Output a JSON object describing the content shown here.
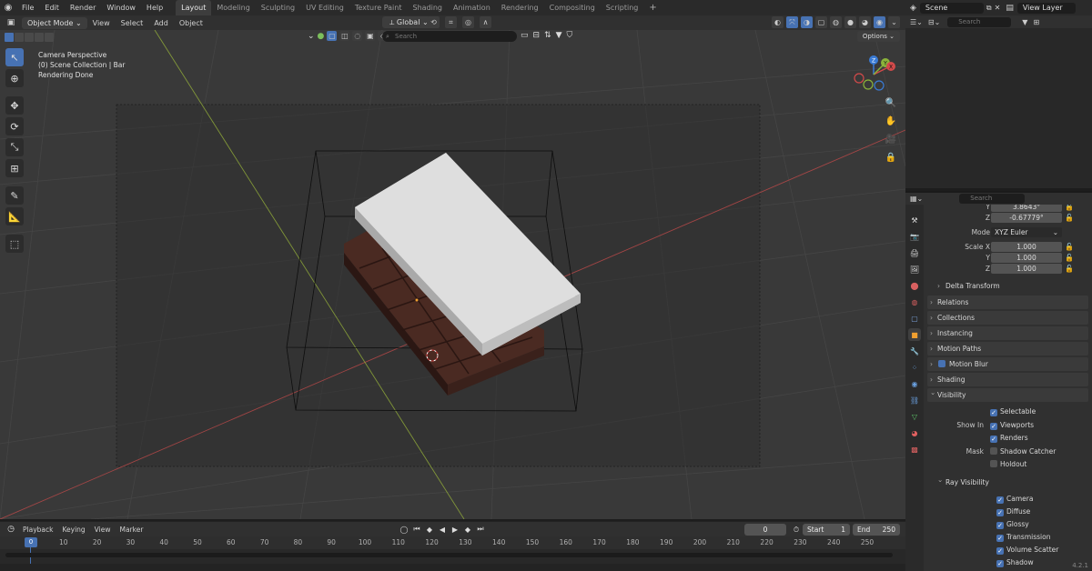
{
  "menubar": {
    "items": [
      "File",
      "Edit",
      "Render",
      "Window",
      "Help"
    ],
    "workspaces": [
      "Layout",
      "Modeling",
      "Sculpting",
      "UV Editing",
      "Texture Paint",
      "Shading",
      "Animation",
      "Rendering",
      "Compositing",
      "Scripting"
    ],
    "active_workspace": "Layout",
    "plus": "+"
  },
  "viewport_header": {
    "mode": "Object Mode",
    "menus": [
      "View",
      "Select",
      "Add",
      "Object"
    ],
    "orientation": "Global"
  },
  "viewport_toolbar2": {
    "search_placeholder": "Search",
    "options": "Options"
  },
  "viewport_info": {
    "line1": "Camera Perspective",
    "line2": "(0) Scene Collection | Bar",
    "line3": "Rendering Done"
  },
  "gizmo": {
    "x": "X",
    "y": "Y",
    "z": "Z"
  },
  "outliner": {
    "scene": "Scene",
    "view_layer": "View Layer",
    "search_placeholder": "Search"
  },
  "properties": {
    "search_placeholder": "Search",
    "rotation_y_label": "Y",
    "rotation_y_value": "3.8643°",
    "rotation_z_label": "Z",
    "rotation_z_value": "-0.67779°",
    "mode_label": "Mode",
    "mode_value": "XYZ Euler",
    "scale_x_label": "Scale X",
    "scale_x_value": "1.000",
    "scale_y_label": "Y",
    "scale_y_value": "1.000",
    "scale_z_label": "Z",
    "scale_z_value": "1.000",
    "delta_transform": "Delta Transform",
    "panels": [
      "Relations",
      "Collections",
      "Instancing",
      "Motion Paths",
      "Motion Blur",
      "Shading",
      "Visibility"
    ],
    "visibility": {
      "selectable": "Selectable",
      "show_in_label": "Show In",
      "viewports": "Viewports",
      "renders": "Renders",
      "mask_label": "Mask",
      "shadow_catcher": "Shadow Catcher",
      "holdout": "Holdout",
      "ray_visibility": "Ray Visibility",
      "rays": [
        "Camera",
        "Diffuse",
        "Glossy",
        "Transmission",
        "Volume Scatter",
        "Shadow"
      ]
    },
    "version": "4.2.1"
  },
  "timeline": {
    "menus": [
      "Playback",
      "Keying",
      "View",
      "Marker"
    ],
    "current_frame": "0",
    "start_label": "Start",
    "start_value": "1",
    "end_label": "End",
    "end_value": "250",
    "ruler_frame": "0",
    "ticks": [
      "10",
      "20",
      "30",
      "40",
      "50",
      "60",
      "70",
      "80",
      "90",
      "100",
      "110",
      "120",
      "130",
      "140",
      "150",
      "160",
      "170",
      "180",
      "190",
      "200",
      "210",
      "220",
      "230",
      "240",
      "250"
    ]
  },
  "colors": {
    "accent": "#4772b3",
    "x_axis": "#d24a4a",
    "y_axis": "#8bb33a",
    "z_axis": "#3a7bd5"
  }
}
